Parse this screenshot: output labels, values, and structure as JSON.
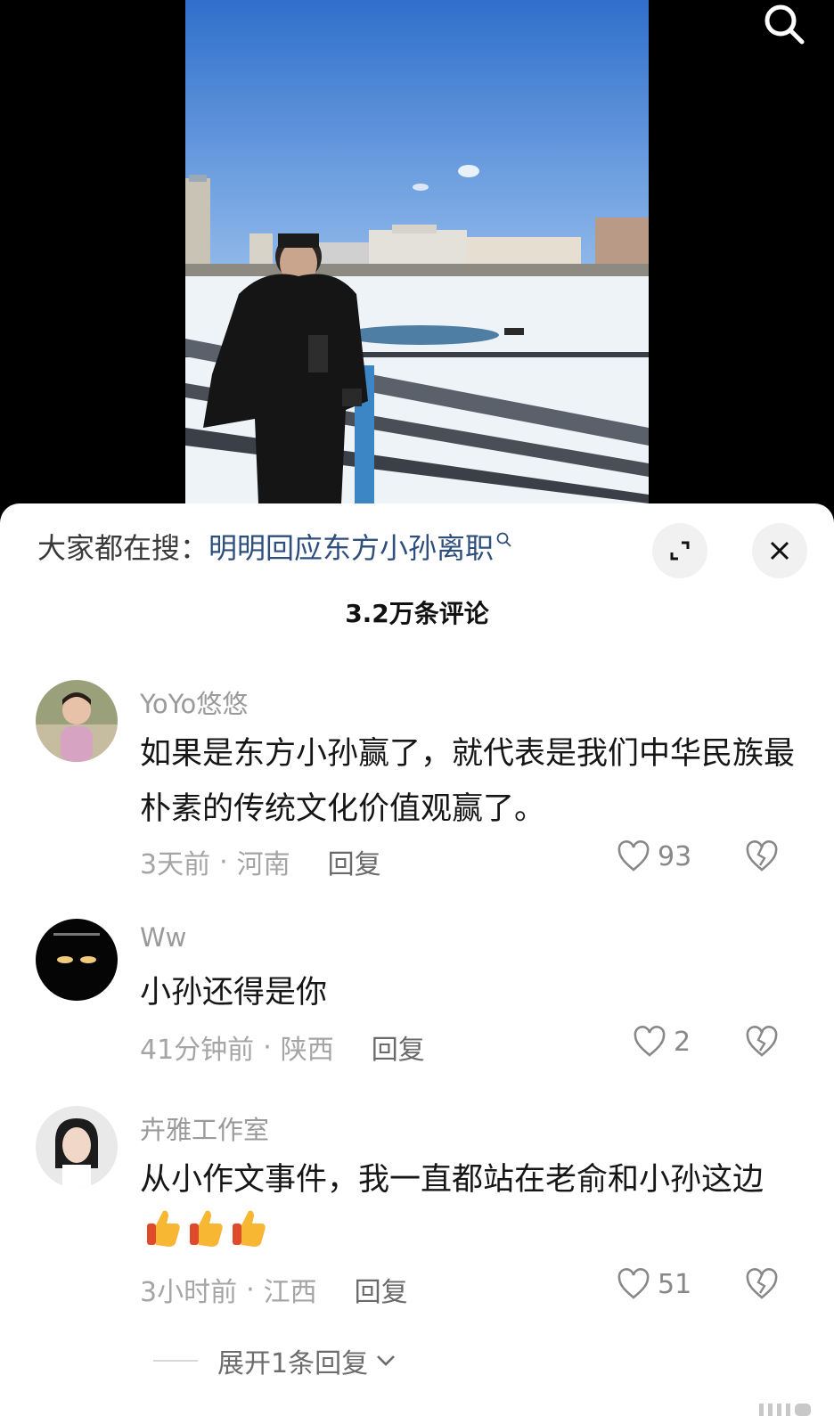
{
  "video": {
    "search_icon": "search-icon"
  },
  "search_bar": {
    "prefix": "大家都在搜：",
    "query": "明明回应东方小孙离职",
    "expand_icon": "expand-icon",
    "close_icon": "close-icon"
  },
  "comments_header": {
    "count_label": "3.2万条评论"
  },
  "comments": [
    {
      "username": "YoYo悠悠",
      "text": "如果是东方小孙赢了，就代表是我们中华民族最朴素的传统文化价值观赢了。",
      "time": "3天前",
      "location": "河南",
      "reply_label": "回复",
      "likes": "93"
    },
    {
      "username": "Ww",
      "text": "小孙还得是你",
      "time": "41分钟前",
      "location": "陕西",
      "reply_label": "回复",
      "likes": "2"
    },
    {
      "username": "卉雅工作室",
      "text": "从小作文事件，我一直都站在老俞和小孙这边",
      "time": "3小时前",
      "location": "江西",
      "reply_label": "回复",
      "likes": "51",
      "expand_replies": "展开1条回复"
    }
  ],
  "meta_separator": "·"
}
